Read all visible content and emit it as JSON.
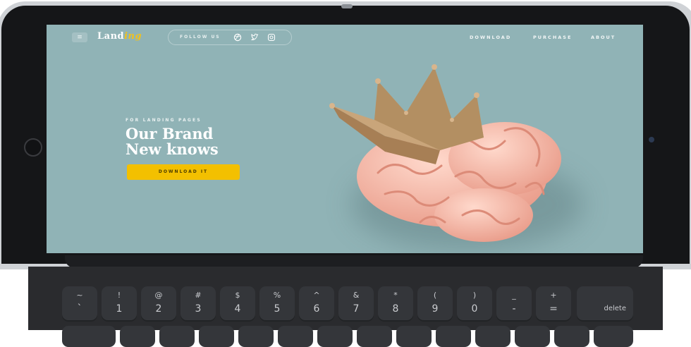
{
  "landing": {
    "menu_icon": "≡",
    "brand_main": "Land",
    "brand_accent": "ing",
    "follow_label": "FOLLOW US",
    "social_icons": [
      "dribbble-icon",
      "twitter-icon",
      "instagram-icon"
    ],
    "nav": [
      "DOWNLOAD",
      "PURCHASE",
      "ABOUT"
    ],
    "kicker": "FOR LANDING PAGES",
    "headline_line1": "Our Brand",
    "headline_line2": "New knows",
    "cta_label": "DOWNLOAD IT",
    "colors": {
      "background": "#90b3b6",
      "accent": "#f3c000"
    }
  },
  "keyboard": {
    "keys": [
      {
        "top": "~",
        "bottom": "`"
      },
      {
        "top": "!",
        "bottom": "1"
      },
      {
        "top": "@",
        "bottom": "2"
      },
      {
        "top": "#",
        "bottom": "3"
      },
      {
        "top": "$",
        "bottom": "4"
      },
      {
        "top": "%",
        "bottom": "5"
      },
      {
        "top": "^",
        "bottom": "6"
      },
      {
        "top": "&",
        "bottom": "7"
      },
      {
        "top": "*",
        "bottom": "8"
      },
      {
        "top": "(",
        "bottom": "9"
      },
      {
        "top": ")",
        "bottom": "0"
      },
      {
        "top": "_",
        "bottom": "-"
      },
      {
        "top": "+",
        "bottom": "="
      }
    ],
    "delete_label": "delete"
  }
}
